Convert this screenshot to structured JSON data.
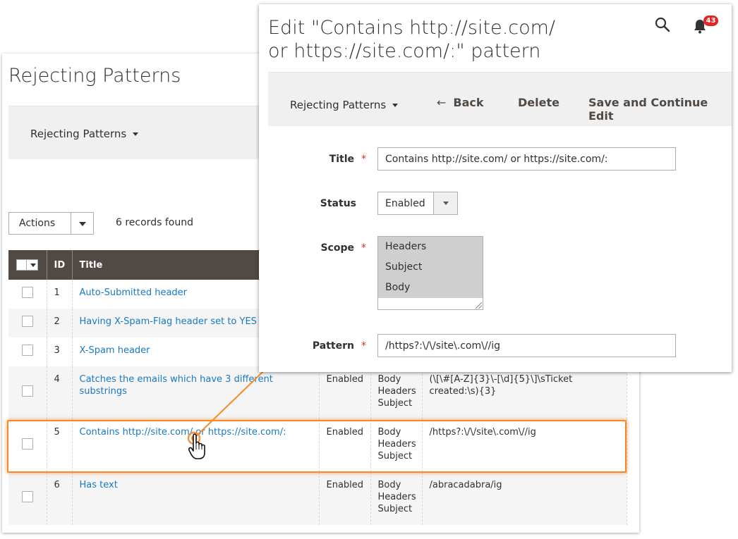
{
  "grid_page": {
    "title": "Rejecting Patterns",
    "switcher_label": "Rejecting Patterns",
    "actions_label": "Actions",
    "records_found": "6 records found",
    "columns": [
      "ID",
      "Title"
    ],
    "rows": [
      {
        "id": "1",
        "title": "Auto-Submitted header",
        "status": "",
        "scope": [],
        "pattern": ""
      },
      {
        "id": "2",
        "title": "Having X-Spam-Flag header set to YES",
        "status": "",
        "scope": [],
        "pattern": ""
      },
      {
        "id": "3",
        "title": "X-Spam header",
        "status": "",
        "scope": [],
        "pattern": ""
      },
      {
        "id": "4",
        "title": "Catches the emails which have 3 different substrings",
        "status": "Enabled",
        "scope": [
          "Body",
          "Headers",
          "Subject"
        ],
        "pattern": "(\\[\\#[A-Z]{3}\\-[\\d]{5}\\]\\sTicket created:\\s){3}"
      },
      {
        "id": "5",
        "title": "Contains http://site.com/ or https://site.com/:",
        "status": "Enabled",
        "scope": [
          "Body",
          "Headers",
          "Subject"
        ],
        "pattern": "/https?:\\/\\/site\\.com\\//ig"
      },
      {
        "id": "6",
        "title": "Has text",
        "status": "Enabled",
        "scope": [
          "Body",
          "Headers",
          "Subject"
        ],
        "pattern": "/abracadabra/ig"
      }
    ]
  },
  "edit_panel": {
    "title_line1": "Edit \"Contains http://site.com/",
    "title_line2": "or https://site.com/:\" pattern",
    "notification_count": "43",
    "toolbar": {
      "switcher_label": "Rejecting Patterns",
      "back_arrow": "←",
      "back_label": "Back",
      "delete_label": "Delete",
      "save_continue_label": "Save and Continue Edit"
    },
    "form": {
      "title_label": "Title",
      "title_value": "Contains http://site.com/ or https://site.com/:",
      "status_label": "Status",
      "status_value": "Enabled",
      "scope_label": "Scope",
      "scope_options": [
        "Headers",
        "Subject",
        "Body"
      ],
      "pattern_label": "Pattern",
      "pattern_value": "/https?:\\/\\/site\\.com\\//ig",
      "required_mark": "*"
    }
  },
  "colors": {
    "grid_header_bg": "#514943",
    "link": "#1979c3",
    "highlight": "#f58a2a",
    "required": "#e02b27",
    "badge": "#e22626"
  }
}
